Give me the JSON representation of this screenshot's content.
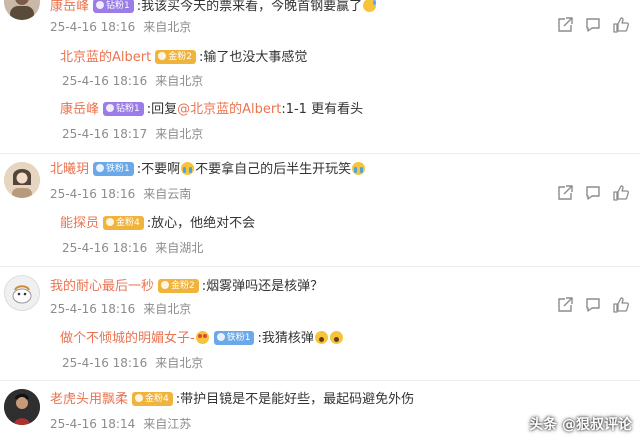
{
  "comments": [
    {
      "username": "康岳峰",
      "badge": "钻粉1",
      "text": ":我该买今天的票来看，今晚首钢要赢了",
      "emoji": "sweat-smile",
      "meta_time": "25-4-16 18:16",
      "meta_location": "来自北京",
      "replies": [
        {
          "username": "北京蓝的Albert",
          "badge": "金粉2",
          "text": ":输了也没大事感觉",
          "meta_time": "25-4-16 18:16",
          "meta_location": "来自北京"
        },
        {
          "username": "康岳峰",
          "badge": "钻粉1",
          "reply_prefix": ":回复",
          "mention": "@北京蓝的Albert",
          "text": ":1-1 更有看头",
          "meta_time": "25-4-16 18:17",
          "meta_location": "来自北京"
        }
      ]
    },
    {
      "username": "北曦玥",
      "badge": "铁粉1",
      "text_a": ":不要啊",
      "text_b": "不要拿自己的后半生开玩笑",
      "emoji": "cry",
      "meta_time": "25-4-16 18:16",
      "meta_location": "来自云南",
      "replies": [
        {
          "username": "能探员",
          "badge": "金粉4",
          "text": ":放心，他绝对不会",
          "meta_time": "25-4-16 18:16",
          "meta_location": "来自湖北"
        }
      ]
    },
    {
      "username": "我的耐心最后一秒",
      "badge": "金粉2",
      "text": ":烟雾弹吗还是核弹？",
      "meta_time": "25-4-16 18:16",
      "meta_location": "来自北京",
      "replies": [
        {
          "username": "做个不倾城的明媚女子-",
          "badge": "铁粉1",
          "text": ":我猜核弹",
          "emoji": "scream",
          "meta_time": "25-4-16 18:16",
          "meta_location": "来自北京"
        }
      ]
    },
    {
      "username": "老虎头用飘柔",
      "badge": "金粉4",
      "text": ":带护目镜是不是能好些，最起码避免外伤",
      "meta_time": "25-4-16 18:14",
      "meta_location": "来自江苏",
      "replies": []
    }
  ],
  "watermark": "头条 @狠叔评论",
  "colors": {
    "username": "#eb7350",
    "meta": "#8c8c8c",
    "badge_diamond": "#9b7de8",
    "badge_iron": "#6aa8e8",
    "badge_gold": "#f0b43c"
  },
  "icons": [
    "share-icon",
    "comment-icon",
    "like-icon"
  ]
}
